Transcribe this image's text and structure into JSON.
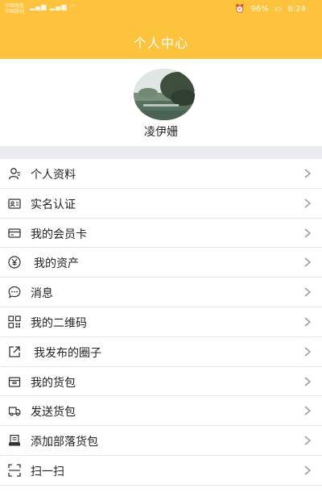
{
  "status_bar": {
    "carrier_1": "中国电信",
    "carrier_2": "中国移动",
    "battery": "96%",
    "time": "6:24"
  },
  "header": {
    "title": "个人中心"
  },
  "profile": {
    "username": "凌伊姗"
  },
  "menu": {
    "items": [
      {
        "label": "个人资料",
        "icon": "user-icon"
      },
      {
        "label": "实名认证",
        "icon": "id-card-icon"
      },
      {
        "label": "我的会员卡",
        "icon": "card-icon"
      },
      {
        "label": "我的资产",
        "icon": "yuan-icon"
      },
      {
        "label": "消息",
        "icon": "message-icon"
      },
      {
        "label": "我的二维码",
        "icon": "qrcode-icon"
      },
      {
        "label": "我发布的圈子",
        "icon": "edit-icon"
      },
      {
        "label": "我的货包",
        "icon": "package-icon"
      },
      {
        "label": "发送货包",
        "icon": "truck-icon"
      },
      {
        "label": "添加部落货包",
        "icon": "add-package-icon"
      },
      {
        "label": "扫一扫",
        "icon": "scan-icon"
      }
    ]
  },
  "colors": {
    "header": "#fdc33c",
    "separator": "#e9ecf1",
    "chevron": "#999999"
  }
}
